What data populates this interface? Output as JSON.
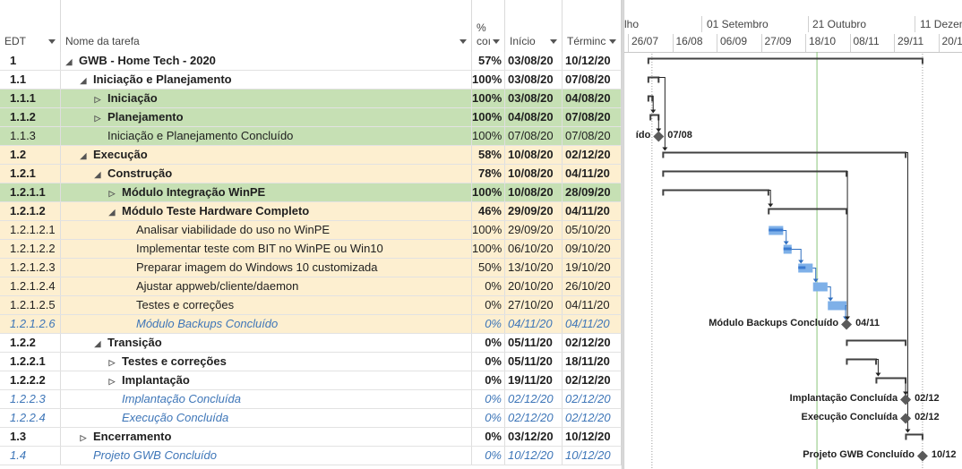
{
  "columns": {
    "edt": "EDT",
    "name": "Nome da tarefa",
    "pct_line1": "%",
    "pct_line2": "coı",
    "start": "Início",
    "finish": "Términc"
  },
  "timeline": {
    "top": [
      "lho",
      "01 Setembro",
      "21 Outubro",
      "11 Dezem"
    ],
    "bottom": [
      "26/07",
      "16/08",
      "06/09",
      "27/09",
      "18/10",
      "08/11",
      "29/11",
      "20/1"
    ]
  },
  "rows": [
    {
      "edt": "1",
      "name": "GWB - Home Tech - 2020",
      "pct": "57%",
      "start": "03/08/20",
      "finish": "10/12/20",
      "level": 0,
      "toggle": "down",
      "style": "bold",
      "bg": "#ffffff"
    },
    {
      "edt": "1.1",
      "name": "Iniciação e Planejamento",
      "pct": "100%",
      "start": "03/08/20",
      "finish": "07/08/20",
      "level": 1,
      "toggle": "down",
      "style": "bold",
      "bg": "#ffffff"
    },
    {
      "edt": "1.1.1",
      "name": "Iniciação",
      "pct": "100%",
      "start": "03/08/20",
      "finish": "04/08/20",
      "level": 2,
      "toggle": "right",
      "style": "bold",
      "bg": "#c6e0b4"
    },
    {
      "edt": "1.1.2",
      "name": "Planejamento",
      "pct": "100%",
      "start": "04/08/20",
      "finish": "07/08/20",
      "level": 2,
      "toggle": "right",
      "style": "bold",
      "bg": "#c6e0b4"
    },
    {
      "edt": "1.1.3",
      "name": "Iniciação e Planejamento Concluído",
      "pct": "100%",
      "start": "07/08/20",
      "finish": "07/08/20",
      "level": 2,
      "toggle": "none",
      "style": "normal",
      "bg": "#c6e0b4"
    },
    {
      "edt": "1.2",
      "name": "Execução",
      "pct": "58%",
      "start": "10/08/20",
      "finish": "02/12/20",
      "level": 1,
      "toggle": "down",
      "style": "bold",
      "bg": "#fdefd0"
    },
    {
      "edt": "1.2.1",
      "name": "Construção",
      "pct": "78%",
      "start": "10/08/20",
      "finish": "04/11/20",
      "level": 2,
      "toggle": "down",
      "style": "bold",
      "bg": "#fdefd0"
    },
    {
      "edt": "1.2.1.1",
      "name": "Módulo Integração WinPE",
      "pct": "100%",
      "start": "10/08/20",
      "finish": "28/09/20",
      "level": 3,
      "toggle": "right",
      "style": "bold",
      "bg": "#c6e0b4"
    },
    {
      "edt": "1.2.1.2",
      "name": "Módulo Teste Hardware Completo",
      "pct": "46%",
      "start": "29/09/20",
      "finish": "04/11/20",
      "level": 3,
      "toggle": "down",
      "style": "bold",
      "bg": "#fdefd0"
    },
    {
      "edt": "1.2.1.2.1",
      "name": "Analisar viabilidade do uso no WinPE",
      "pct": "100%",
      "start": "29/09/20",
      "finish": "05/10/20",
      "level": 4,
      "toggle": "none",
      "style": "normal",
      "bg": "#fdefd0"
    },
    {
      "edt": "1.2.1.2.2",
      "name": "Implementar teste com BIT no WinPE ou Win10",
      "pct": "100%",
      "start": "06/10/20",
      "finish": "09/10/20",
      "level": 4,
      "toggle": "none",
      "style": "normal",
      "bg": "#fdefd0"
    },
    {
      "edt": "1.2.1.2.3",
      "name": "Preparar imagem do Windows 10 customizada",
      "pct": "50%",
      "start": "13/10/20",
      "finish": "19/10/20",
      "level": 4,
      "toggle": "none",
      "style": "normal",
      "bg": "#fdefd0"
    },
    {
      "edt": "1.2.1.2.4",
      "name": "Ajustar appweb/cliente/daemon",
      "pct": "0%",
      "start": "20/10/20",
      "finish": "26/10/20",
      "level": 4,
      "toggle": "none",
      "style": "normal",
      "bg": "#fdefd0"
    },
    {
      "edt": "1.2.1.2.5",
      "name": "Testes e correções",
      "pct": "0%",
      "start": "27/10/20",
      "finish": "04/11/20",
      "level": 4,
      "toggle": "none",
      "style": "normal",
      "bg": "#fdefd0"
    },
    {
      "edt": "1.2.1.2.6",
      "name": "Módulo Backups Concluído",
      "pct": "0%",
      "start": "04/11/20",
      "finish": "04/11/20",
      "level": 4,
      "toggle": "none",
      "style": "italic",
      "bg": "#fdefd0"
    },
    {
      "edt": "1.2.2",
      "name": "Transição",
      "pct": "0%",
      "start": "05/11/20",
      "finish": "02/12/20",
      "level": 2,
      "toggle": "down",
      "style": "bold",
      "bg": "#ffffff"
    },
    {
      "edt": "1.2.2.1",
      "name": "Testes e correções",
      "pct": "0%",
      "start": "05/11/20",
      "finish": "18/11/20",
      "level": 3,
      "toggle": "right",
      "style": "bold",
      "bg": "#ffffff"
    },
    {
      "edt": "1.2.2.2",
      "name": "Implantação",
      "pct": "0%",
      "start": "19/11/20",
      "finish": "02/12/20",
      "level": 3,
      "toggle": "right",
      "style": "bold",
      "bg": "#ffffff"
    },
    {
      "edt": "1.2.2.3",
      "name": "Implantação Concluída",
      "pct": "0%",
      "start": "02/12/20",
      "finish": "02/12/20",
      "level": 3,
      "toggle": "none",
      "style": "italic",
      "bg": "#ffffff"
    },
    {
      "edt": "1.2.2.4",
      "name": "Execução Concluída",
      "pct": "0%",
      "start": "02/12/20",
      "finish": "02/12/20",
      "level": 3,
      "toggle": "none",
      "style": "italic",
      "bg": "#ffffff"
    },
    {
      "edt": "1.3",
      "name": "Encerramento",
      "pct": "0%",
      "start": "03/12/20",
      "finish": "10/12/20",
      "level": 1,
      "toggle": "right",
      "style": "bold",
      "bg": "#ffffff"
    },
    {
      "edt": "1.4",
      "name": "Projeto GWB Concluído",
      "pct": "0%",
      "start": "10/12/20",
      "finish": "10/12/20",
      "level": 1,
      "toggle": "none",
      "style": "italic",
      "bg": "#ffffff"
    }
  ],
  "milestones": [
    {
      "row": 4,
      "label": "ído",
      "date": "07/08"
    },
    {
      "row": 14,
      "label": "Módulo Backups Concluído",
      "date": "04/11"
    },
    {
      "row": 18,
      "label": "Implantação Concluída",
      "date": "02/12"
    },
    {
      "row": 19,
      "label": "Execução Concluída",
      "date": "02/12"
    },
    {
      "row": 21,
      "label": "Projeto GWB Concluído",
      "date": "10/12"
    }
  ],
  "colors": {
    "green_row": "#c6e0b4",
    "yellow_row": "#fdefd0",
    "bar_blue": "#7eb0e8",
    "bar_blue_done": "#3a7ad0",
    "summary_bar": "#404040",
    "link_blue": "#2f6fc0",
    "today_line": "#8bc47a",
    "italic_text": "#3e76b8"
  }
}
